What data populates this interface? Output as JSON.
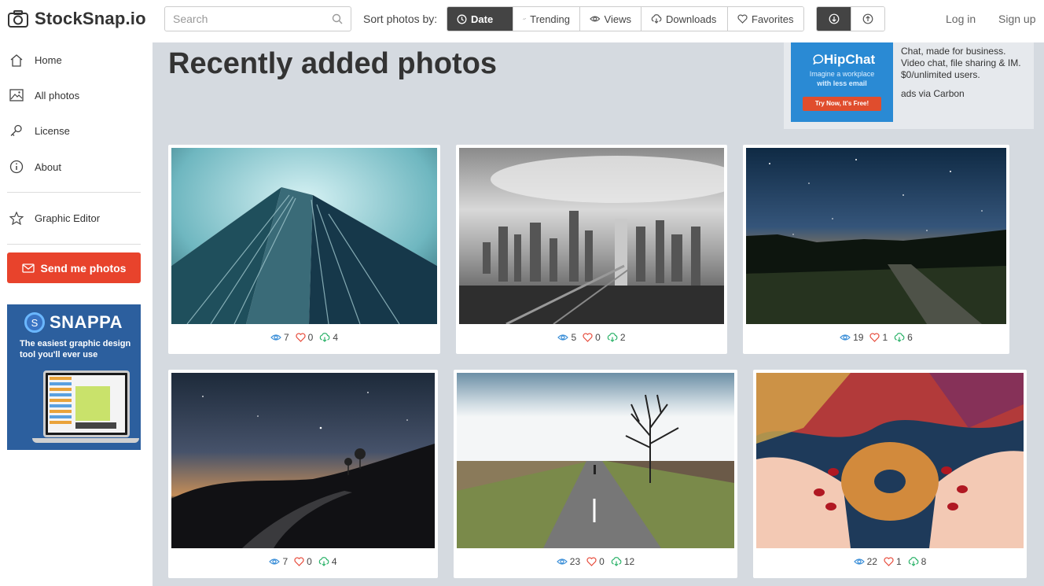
{
  "brand": {
    "name": "StockSnap.io"
  },
  "search": {
    "placeholder": "Search"
  },
  "sort": {
    "label": "Sort photos by:",
    "options": [
      "Date",
      "Trending",
      "Views",
      "Downloads",
      "Favorites"
    ],
    "active": "Date"
  },
  "auth": {
    "login": "Log in",
    "signup": "Sign up"
  },
  "sidebar": {
    "items": [
      "Home",
      "All photos",
      "License",
      "About"
    ],
    "editor": "Graphic Editor",
    "send_button": "Send me photos",
    "snappa": {
      "name": "SNAPPA",
      "logo_letter": "S",
      "tagline": "The easiest graphic design tool you'll ever use"
    }
  },
  "main": {
    "title": "Recently added photos",
    "ad": {
      "brand": "HipChat",
      "sub_a": "Imagine a workplace",
      "sub_b": "with less email",
      "cta": "Try Now, It's Free!",
      "text": "Chat, made for business. Video chat, file sharing & IM. $0/unlimited users.",
      "via": "ads via Carbon"
    },
    "photos": [
      {
        "subject": "skyscraper",
        "views": "7",
        "favorites": "0",
        "downloads": "4"
      },
      {
        "subject": "city-aerial",
        "views": "5",
        "favorites": "0",
        "downloads": "2"
      },
      {
        "subject": "milky-way-field",
        "views": "19",
        "favorites": "1",
        "downloads": "6"
      },
      {
        "subject": "starry-road",
        "views": "7",
        "favorites": "0",
        "downloads": "4"
      },
      {
        "subject": "tree-road",
        "views": "23",
        "favorites": "0",
        "downloads": "12"
      },
      {
        "subject": "donut-hands",
        "views": "22",
        "favorites": "1",
        "downloads": "8"
      }
    ]
  },
  "colors": {
    "accent": "#e8432c",
    "stats_view": "#3b8fd8",
    "stats_fav": "#e74c3c",
    "stats_dl": "#2eb36b",
    "main_bg": "#d5dae0"
  }
}
